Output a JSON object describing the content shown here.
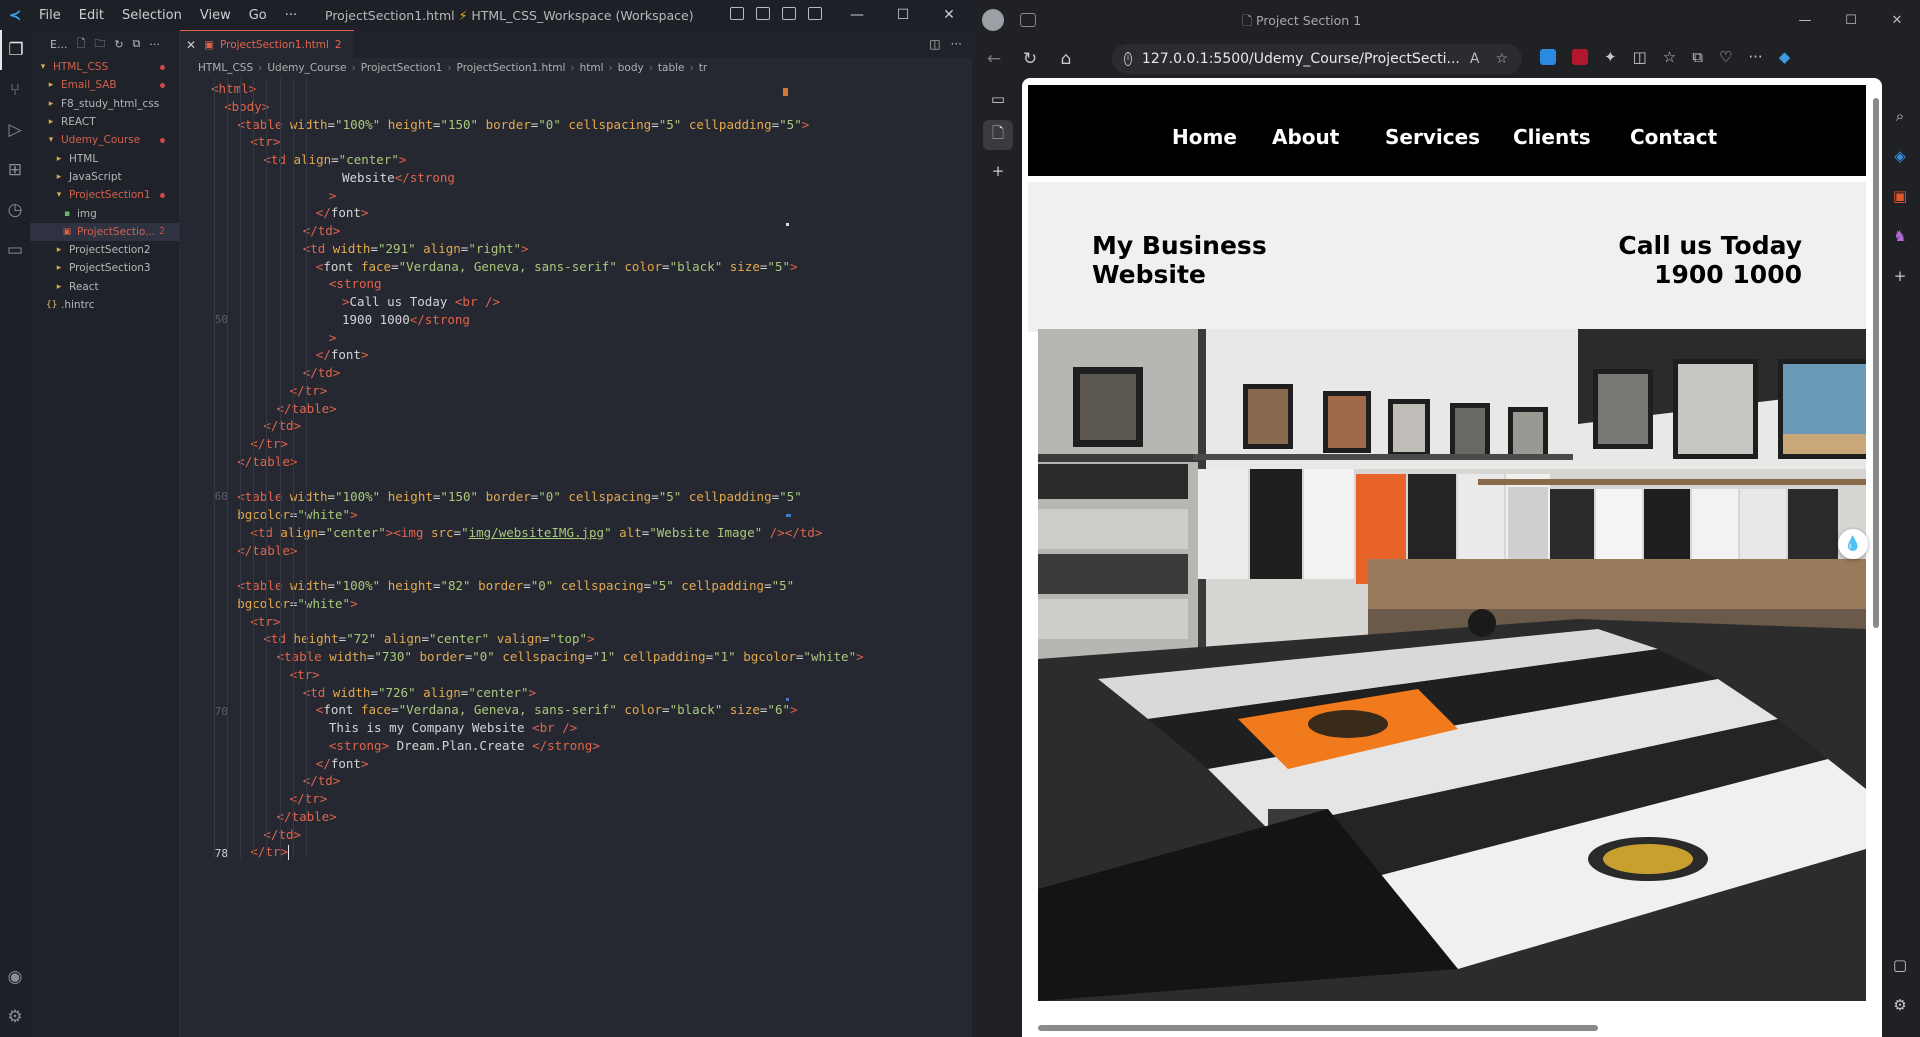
{
  "vscode": {
    "menu": [
      "File",
      "Edit",
      "Selection",
      "View",
      "Go",
      "···"
    ],
    "title": "ProjectSection1.html",
    "title_separator": "⚡",
    "title_workspace": "HTML_CSS_Workspace (Workspace)",
    "explorer_header": "E...",
    "tree": [
      {
        "label": "HTML_CSS",
        "type": "folder-open",
        "indent": 0,
        "color": "red",
        "dot": true
      },
      {
        "label": "Email_SAB",
        "type": "folder",
        "indent": 1,
        "color": "red",
        "dot": true
      },
      {
        "label": "F8_study_html_css",
        "type": "folder",
        "indent": 1,
        "color": "normal"
      },
      {
        "label": "REACT",
        "type": "folder",
        "indent": 1,
        "color": "normal"
      },
      {
        "label": "Udemy_Course",
        "type": "folder-open",
        "indent": 1,
        "color": "red",
        "dot": true
      },
      {
        "label": "HTML",
        "type": "folder",
        "indent": 2,
        "color": "normal"
      },
      {
        "label": "JavaScript",
        "type": "folder",
        "indent": 2,
        "color": "normal"
      },
      {
        "label": "ProjectSection1",
        "type": "folder-open",
        "indent": 2,
        "color": "red",
        "dot": true
      },
      {
        "label": "img",
        "type": "img",
        "indent": 3,
        "color": "normal"
      },
      {
        "label": "ProjectSectio...",
        "type": "html",
        "indent": 3,
        "color": "red",
        "count": "2",
        "selected": true
      },
      {
        "label": "ProjectSection2",
        "type": "folder",
        "indent": 2,
        "color": "normal"
      },
      {
        "label": "ProjectSection3",
        "type": "folder",
        "indent": 2,
        "color": "normal"
      },
      {
        "label": "React",
        "type": "folder",
        "indent": 2,
        "color": "normal"
      },
      {
        "label": ".hintrc",
        "type": "json",
        "indent": 1,
        "color": "normal"
      }
    ],
    "tab": {
      "label": "ProjectSection1.html",
      "problems": "2"
    },
    "breadcrumb": [
      "HTML_CSS",
      "Udemy_Course",
      "ProjectSection1",
      "ProjectSection1.html",
      "html",
      "body",
      "table",
      "tr"
    ],
    "line_numbers": {
      "50": "50",
      "60": "60",
      "70": "70",
      "78": "78"
    },
    "code_lines": [
      {
        "indent": 0,
        "html": "<span class='tg'>&lt;html&gt;</span>"
      },
      {
        "indent": 1,
        "html": "<span class='tg'>&lt;body&gt;</span>"
      },
      {
        "indent": 2,
        "html": "<span class='tg'>&lt;table</span> <span class='at'>width</span>=<span class='vl'>\"100%\"</span> <span class='at'>height</span>=<span class='vl'>\"150\"</span> <span class='at'>border</span>=<span class='vl'>\"0\"</span> <span class='at'>cellspacing</span>=<span class='vl'>\"5\"</span> <span class='at'>cellpadding</span>=<span class='vl'>\"5\"</span><span class='tg'>&gt;</span>"
      },
      {
        "indent": 3,
        "html": "<span class='tg'>&lt;tr&gt;</span>"
      },
      {
        "indent": 4,
        "html": "<span class='tg'>&lt;td</span> <span class='at'>align</span>=<span class='vl'>\"center\"</span><span class='tg'>&gt;</span>"
      },
      {
        "indent": 10,
        "html": "Website<span class='tg'>&lt;/strong</span>"
      },
      {
        "indent": 9,
        "html": "<span class='tg'>&gt;</span>"
      },
      {
        "indent": 8,
        "html": "<span class='tg'>&lt;/</span>font<span class='tg'>&gt;</span>"
      },
      {
        "indent": 7,
        "html": "<span class='tg'>&lt;/td&gt;</span>"
      },
      {
        "indent": 7,
        "html": "<span class='tg'>&lt;td</span> <span class='at'>width</span>=<span class='vl'>\"291\"</span> <span class='at'>align</span>=<span class='vl'>\"right\"</span><span class='tg'>&gt;</span>"
      },
      {
        "indent": 8,
        "html": "<span class='tg'>&lt;</span>font <span class='at'>face</span>=<span class='vl'>\"Verdana, Geneva, sans-serif\"</span> <span class='at'>color</span>=<span class='vl'>\"black\"</span> <span class='at'>size</span>=<span class='vl'>\"5\"</span><span class='tg'>&gt;</span>"
      },
      {
        "indent": 9,
        "html": "<span class='tg'>&lt;strong</span>"
      },
      {
        "indent": 10,
        "html": "<span class='tg'>&gt;</span>Call us Today <span class='tg'>&lt;br /&gt;</span>"
      },
      {
        "indent": 10,
        "html": "1900 1000<span class='tg'>&lt;/strong</span>"
      },
      {
        "indent": 9,
        "html": "<span class='tg'>&gt;</span>"
      },
      {
        "indent": 8,
        "html": "<span class='tg'>&lt;/</span>font<span class='tg'>&gt;</span>"
      },
      {
        "indent": 7,
        "html": "<span class='tg'>&lt;/td&gt;</span>"
      },
      {
        "indent": 6,
        "html": "<span class='tg'>&lt;/tr&gt;</span>"
      },
      {
        "indent": 5,
        "html": "<span class='tg'>&lt;/table&gt;</span>"
      },
      {
        "indent": 4,
        "html": "<span class='tg'>&lt;/td&gt;</span>"
      },
      {
        "indent": 3,
        "html": "<span class='tg'>&lt;/tr&gt;</span>"
      },
      {
        "indent": 2,
        "html": "<span class='tg'>&lt;/table&gt;</span>"
      },
      {
        "indent": 0,
        "html": ""
      },
      {
        "indent": 2,
        "html": "<span class='tg'>&lt;table</span> <span class='at'>width</span>=<span class='vl'>\"100%\"</span> <span class='at'>height</span>=<span class='vl'>\"150\"</span> <span class='at'>border</span>=<span class='vl'>\"0\"</span> <span class='at'>cellspacing</span>=<span class='vl'>\"5\"</span> <span class='at'>cellpadding</span>=<span class='vl'>\"5\"</span>"
      },
      {
        "indent": 2,
        "html": "<span class='at'>bgcolor</span>=<span class='vl'>\"white\"</span><span class='tg'>&gt;</span>"
      },
      {
        "indent": 3,
        "html": "<span class='tg'>&lt;td</span> <span class='at'>align</span>=<span class='vl'>\"center\"</span><span class='tg'>&gt;&lt;img</span> <span class='at'>src</span>=<span class='vl'>\"<span class='ul'>img/websiteIMG.jpg</span>\"</span> <span class='at'>alt</span>=<span class='vl'>\"Website Image\"</span> <span class='tg'>/&gt;&lt;/td&gt;</span>"
      },
      {
        "indent": 2,
        "html": "<span class='tg'>&lt;/table&gt;</span>"
      },
      {
        "indent": 0,
        "html": ""
      },
      {
        "indent": 2,
        "html": "<span class='tg'>&lt;table</span> <span class='at'>width</span>=<span class='vl'>\"100%\"</span> <span class='at'>height</span>=<span class='vl'>\"82\"</span> <span class='at'>border</span>=<span class='vl'>\"0\"</span> <span class='at'>cellspacing</span>=<span class='vl'>\"5\"</span> <span class='at'>cellpadding</span>=<span class='vl'>\"5\"</span>"
      },
      {
        "indent": 2,
        "html": "<span class='at'>bgcolor</span>=<span class='vl'>\"white\"</span><span class='tg'>&gt;</span>"
      },
      {
        "indent": 3,
        "html": "<span class='tg'>&lt;tr&gt;</span>"
      },
      {
        "indent": 4,
        "html": "<span class='tg'>&lt;td</span> <span class='at'>height</span>=<span class='vl'>\"72\"</span> <span class='at'>align</span>=<span class='vl'>\"center\"</span> <span class='at'>valign</span>=<span class='vl'>\"top\"</span><span class='tg'>&gt;</span>"
      },
      {
        "indent": 5,
        "html": "<span class='tg'>&lt;table</span> <span class='at'>width</span>=<span class='vl'>\"730\"</span> <span class='at'>border</span>=<span class='vl'>\"0\"</span> <span class='at'>cellspacing</span>=<span class='vl'>\"1\"</span> <span class='at'>cellpadding</span>=<span class='vl'>\"1\"</span> <span class='at'>bgcolor</span>=<span class='vl'>\"white\"</span><span class='tg'>&gt;</span>"
      },
      {
        "indent": 6,
        "html": "<span class='tg'>&lt;tr&gt;</span>"
      },
      {
        "indent": 7,
        "html": "<span class='tg'>&lt;td</span> <span class='at'>width</span>=<span class='vl'>\"726\"</span> <span class='at'>align</span>=<span class='vl'>\"center\"</span><span class='tg'>&gt;</span>"
      },
      {
        "indent": 8,
        "html": "<span class='tg'>&lt;</span>font <span class='at'>face</span>=<span class='vl'>\"Verdana, Geneva, sans-serif\"</span> <span class='at'>color</span>=<span class='vl'>\"black\"</span> <span class='at'>size</span>=<span class='vl'>\"6\"</span><span class='tg'>&gt;</span>"
      },
      {
        "indent": 9,
        "html": "This is my Company Website <span class='tg'>&lt;br /&gt;</span>"
      },
      {
        "indent": 9,
        "html": "<span class='tg'>&lt;strong&gt;</span> Dream.Plan.Create <span class='tg'>&lt;/strong&gt;</span>"
      },
      {
        "indent": 8,
        "html": "<span class='tg'>&lt;/</span>font<span class='tg'>&gt;</span>"
      },
      {
        "indent": 7,
        "html": "<span class='tg'>&lt;/td&gt;</span>"
      },
      {
        "indent": 6,
        "html": "<span class='tg'>&lt;/tr&gt;</span>"
      },
      {
        "indent": 5,
        "html": "<span class='tg'>&lt;/table&gt;</span>"
      },
      {
        "indent": 4,
        "html": "<span class='tg'>&lt;/td&gt;</span>"
      },
      {
        "indent": 3,
        "html": "<span class='tg'>&lt;/tr&gt;</span><span class='cursor'></span>"
      }
    ]
  },
  "browser": {
    "tab_title": "Project Section 1",
    "url": "127.0.0.1:5500/Udemy_Course/ProjectSecti...",
    "page": {
      "nav": [
        "Home",
        "About",
        "Services",
        "Clients",
        "Contact"
      ],
      "brand_line1": "My Business",
      "brand_line2": "Website",
      "call_line1": "Call us Today",
      "call_line2": "1900 1000",
      "image_alt": "Website Image"
    }
  }
}
